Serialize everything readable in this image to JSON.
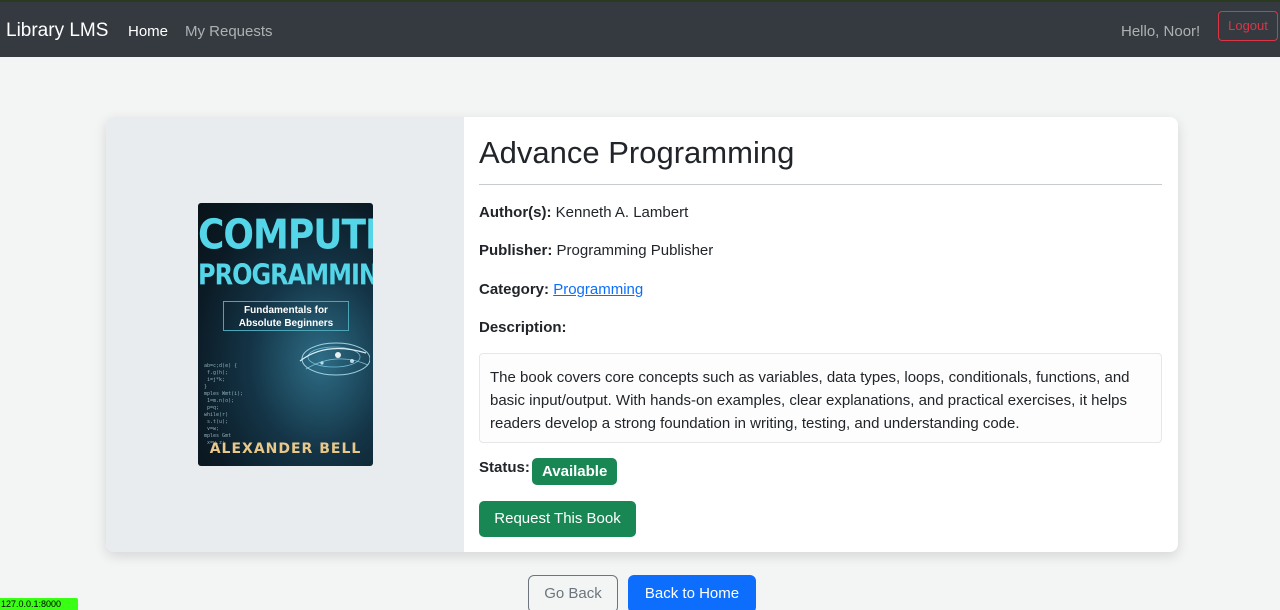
{
  "nav": {
    "brand": "Library LMS",
    "links": [
      "Home",
      "My Requests"
    ],
    "greeting": "Hello, Noor!",
    "logout_label": "Logout"
  },
  "book": {
    "title": "Advance Programming",
    "author_label": "Author(s):",
    "author": "Kenneth A. Lambert",
    "publisher_label": "Publisher:",
    "publisher": "Programming Publisher",
    "category_label": "Category:",
    "category": "Programming",
    "description_label": "Description:",
    "description": "The book covers core concepts such as variables, data types, loops, conditionals, functions, and basic input/output. With hands-on examples, clear explanations, and practical exercises, it helps readers develop a strong foundation in writing, testing, and understanding code.",
    "status_label": "Status:",
    "status": "Available",
    "status_color": "#198754",
    "request_label": "Request This Book"
  },
  "cover": {
    "title_line1": "COMPUTER",
    "title_line2": "PROGRAMMING",
    "subtitle": "Fundamentals for Absolute Beginners",
    "author": "ALEXANDER BELL"
  },
  "footer_buttons": {
    "back_label": "Go Back",
    "home_label": "Back to Home"
  },
  "status_bar": {
    "url": "127.0.0.1:8000"
  },
  "colors": {
    "navbar": "#343a40",
    "primary": "#0d6efd",
    "success": "#198754",
    "danger": "#dc3545"
  }
}
